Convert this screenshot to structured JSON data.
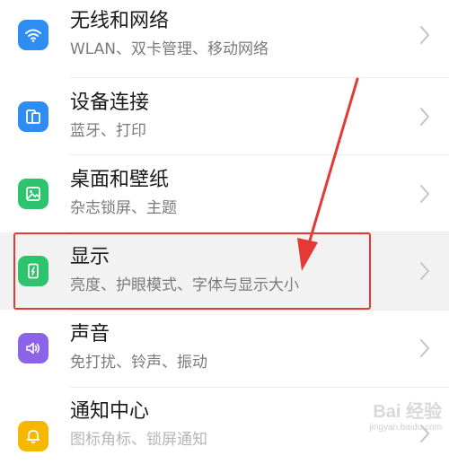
{
  "settings": {
    "items": [
      {
        "title": "无线和网络",
        "subtitle": "WLAN、双卡管理、移动网络",
        "icon": "wifi-icon",
        "color": "#2f8cf0"
      },
      {
        "title": "设备连接",
        "subtitle": "蓝牙、打印",
        "icon": "device-connect-icon",
        "color": "#2f8cf0"
      },
      {
        "title": "桌面和壁纸",
        "subtitle": "杂志锁屏、主题",
        "icon": "wallpaper-icon",
        "color": "#2ec36d"
      },
      {
        "title": "显示",
        "subtitle": "亮度、护眼模式、字体与显示大小",
        "icon": "display-icon",
        "color": "#2ec36d"
      },
      {
        "title": "声音",
        "subtitle": "免打扰、铃声、振动",
        "icon": "sound-icon",
        "color": "#8b63e8"
      },
      {
        "title": "通知中心",
        "subtitle": "图标角标、锁屏通知",
        "icon": "bell-icon",
        "color": "#f5b700"
      }
    ]
  },
  "annotation": {
    "highlight_color": "#e53935"
  },
  "watermark": {
    "main": "Bai 经验",
    "sub": "jingyan.baidu.com"
  }
}
